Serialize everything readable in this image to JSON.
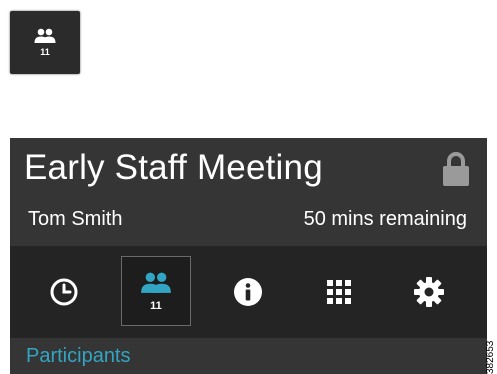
{
  "mini_icon": {
    "icon": "participants-icon",
    "count": "11"
  },
  "meeting": {
    "title": "Early Staff Meeting",
    "organizer": "Tom Smith",
    "time_remaining": "50 mins remaining",
    "lock_icon": "lock-icon"
  },
  "toolbar": {
    "items": [
      {
        "icon": "clock-icon"
      },
      {
        "icon": "participants-icon",
        "count": "11",
        "selected": true
      },
      {
        "icon": "info-icon"
      },
      {
        "icon": "keypad-icon"
      },
      {
        "icon": "gear-icon"
      }
    ]
  },
  "section": {
    "label": "Participants"
  },
  "figure_id": "382653",
  "colors": {
    "panel_bg": "#353535",
    "toolbar_bg": "#242424",
    "accent": "#33a5c4",
    "text": "#ffffff",
    "lock": "#9a9a9a"
  }
}
